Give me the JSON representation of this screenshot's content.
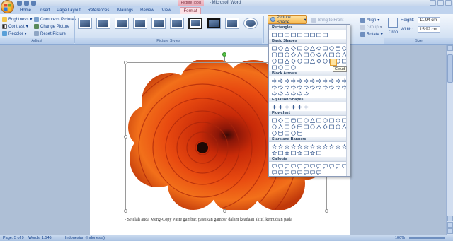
{
  "window": {
    "title": "Microsoft Word",
    "context_tab_group": "Picture Tools"
  },
  "tabs": [
    "Home",
    "Insert",
    "Page Layout",
    "References",
    "Mailings",
    "Review",
    "View",
    "Format"
  ],
  "active_tab": "Format",
  "ribbon": {
    "adjust": {
      "label": "Adjust",
      "brightness": "Brightness",
      "contrast": "Contrast",
      "recolor": "Recolor",
      "compress": "Compress Pictures",
      "change": "Change Picture",
      "reset": "Reset Picture"
    },
    "picture_styles": {
      "label": "Picture Styles"
    },
    "picture_shape": "Picture Shape",
    "arrange": {
      "bring_to_front": "Bring to Front",
      "align": "Align",
      "group": "Group",
      "rotate": "Rotate"
    },
    "size": {
      "label": "Size",
      "crop": "Crop",
      "height_label": "Height:",
      "height_value": "11,94 cm",
      "width_label": "Width:",
      "width_value": "15,92 cm"
    }
  },
  "dropdown": {
    "categories": [
      "Rectangles",
      "Basic Shapes",
      "Block Arrows",
      "Equation Shapes",
      "Flowchart",
      "Stars and Banners",
      "Callouts"
    ],
    "tooltip": "Cloud"
  },
  "document": {
    "body_text": "Setelah anda Meng-Copy Paste gambar, pastikan gambar dalam keadaan aktif, kemudian pada"
  },
  "status": {
    "page": "Page: 5 of 9",
    "words": "Words: 1.546",
    "language": "Indonesian (Indonesia)",
    "zoom": "100%"
  },
  "colors": {
    "accent": "#f7b84e",
    "ribbon": "#dde8f6",
    "context_tab": "#e7a5b3"
  }
}
